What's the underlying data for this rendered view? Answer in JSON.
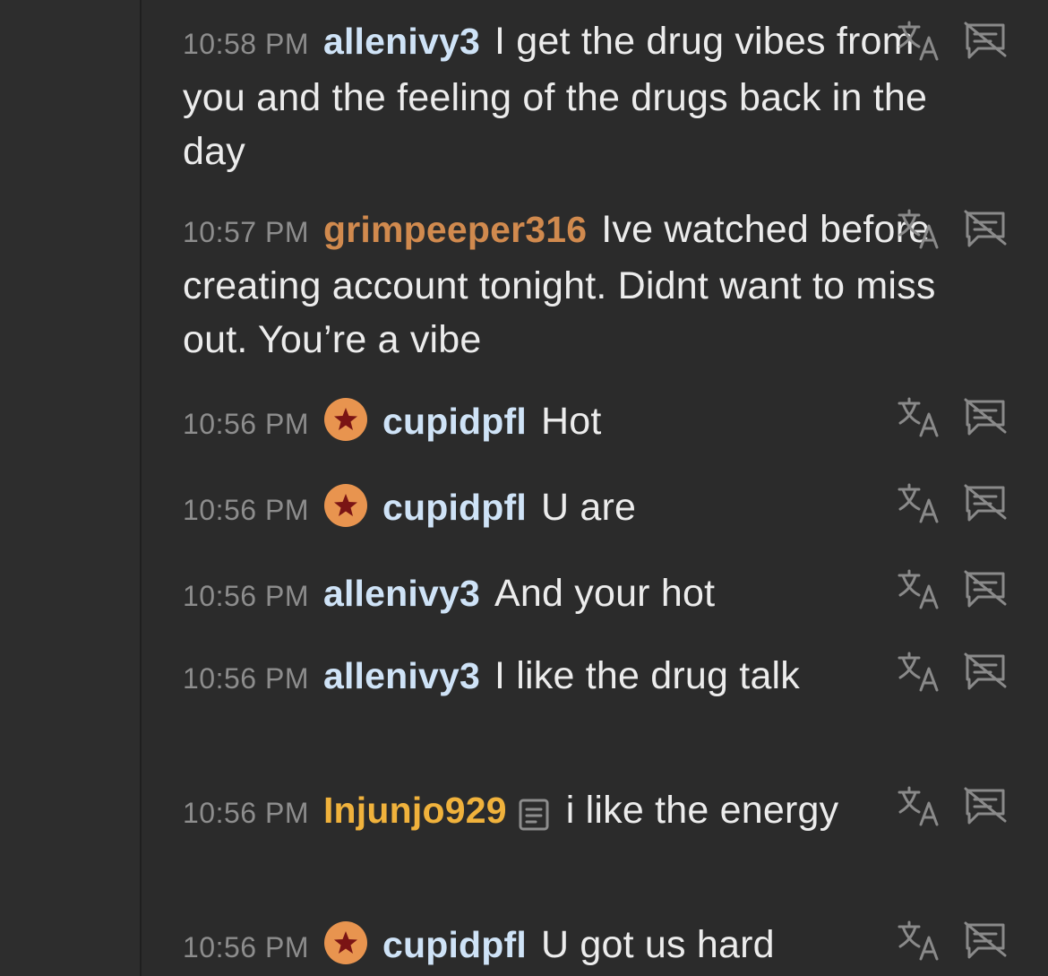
{
  "colors": {
    "background": "#2b2b2b",
    "timestamp": "#8d8d8d",
    "message_text": "#ececec",
    "icon": "#8a8a8a"
  },
  "messages": [
    {
      "time": "10:58 PM",
      "user": "allenivy3",
      "user_color": "#cfe3f7",
      "badge": false,
      "note_icon": false,
      "text": "I get the drug vibes from you and the feeling of the drugs back in the day"
    },
    {
      "time": "10:57 PM",
      "user": "grimpeeper316",
      "user_color": "#d18a4e",
      "badge": false,
      "note_icon": false,
      "text": "Ive watched before creating account tonight. Didnt want to miss out. You’re a vibe"
    },
    {
      "time": "10:56 PM",
      "user": "cupidpfl",
      "user_color": "#cfe3f7",
      "badge": true,
      "note_icon": false,
      "text": "Hot"
    },
    {
      "time": "10:56 PM",
      "user": "cupidpfl",
      "user_color": "#cfe3f7",
      "badge": true,
      "note_icon": false,
      "text": "U are"
    },
    {
      "time": "10:56 PM",
      "user": "allenivy3",
      "user_color": "#cfe3f7",
      "badge": false,
      "note_icon": false,
      "text": "And your hot"
    },
    {
      "time": "10:56 PM",
      "user": "allenivy3",
      "user_color": "#cfe3f7",
      "badge": false,
      "note_icon": false,
      "text": "I like the drug talk"
    },
    {
      "time": "10:56 PM",
      "user": "Injunjo929",
      "user_color": "#f0b23c",
      "badge": false,
      "note_icon": true,
      "text": "i like the energy"
    },
    {
      "time": "10:56 PM",
      "user": "cupidpfl",
      "user_color": "#cfe3f7",
      "badge": true,
      "note_icon": false,
      "text": "U got us hard"
    }
  ],
  "icons": {
    "translate": "translate-icon",
    "hide": "hide-message-icon",
    "badge": "star-badge-icon",
    "note": "user-note-icon"
  }
}
